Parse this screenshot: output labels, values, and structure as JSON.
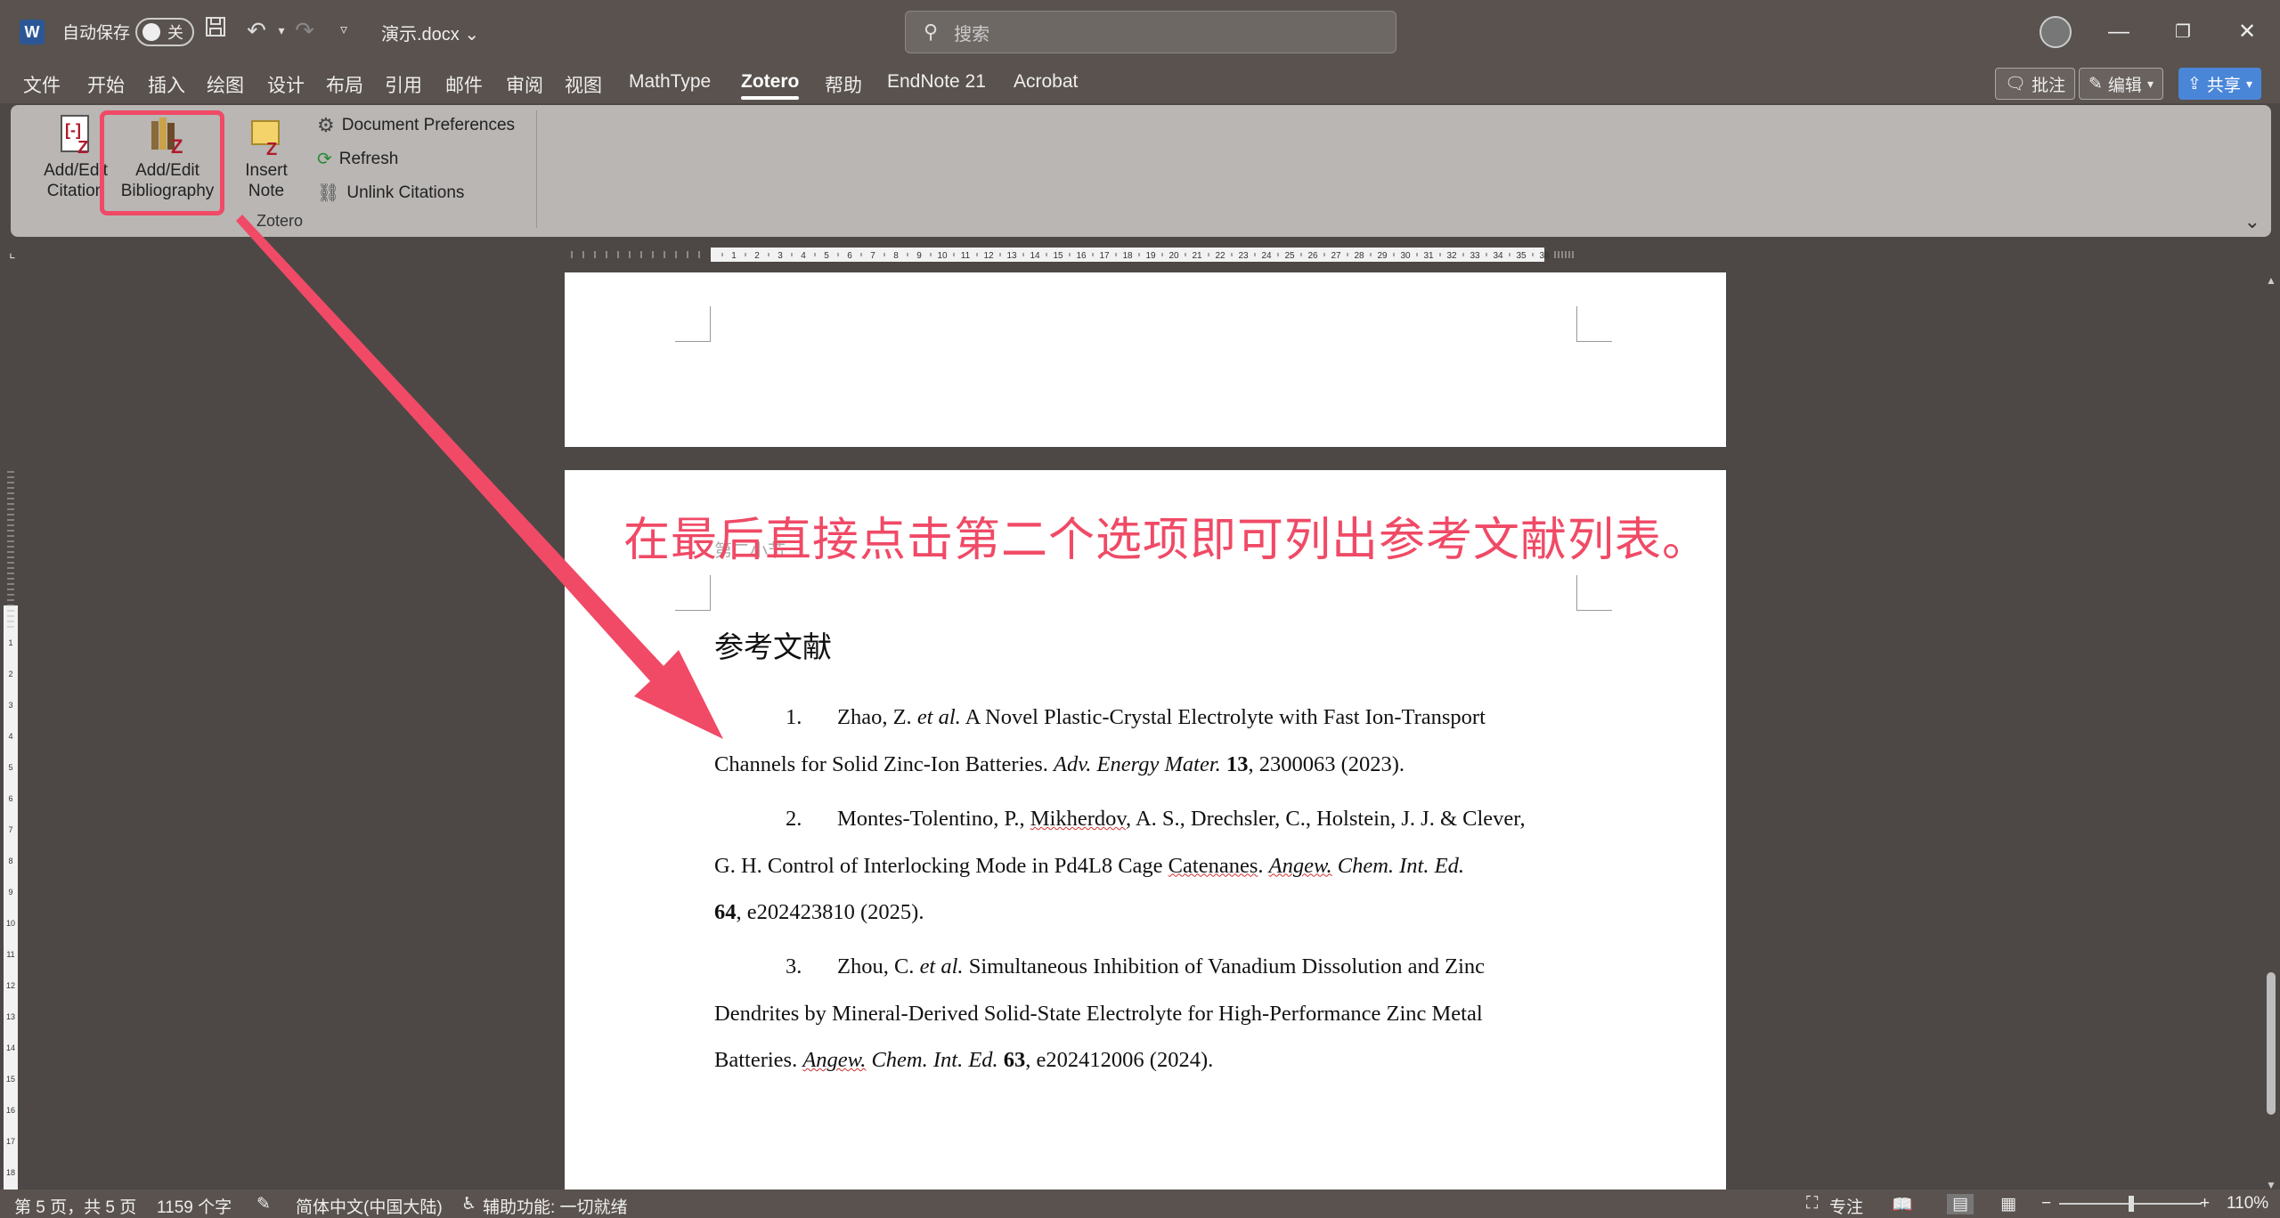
{
  "titlebar": {
    "autosave_label": "自动保存",
    "autosave_state": "关",
    "doc_name": "演示.docx",
    "search_placeholder": "搜索"
  },
  "menu": [
    "文件",
    "开始",
    "插入",
    "绘图",
    "设计",
    "布局",
    "引用",
    "邮件",
    "审阅",
    "视图",
    "MathType",
    "Zotero",
    "帮助",
    "EndNote 21",
    "Acrobat"
  ],
  "active_menu": "Zotero",
  "top_right": {
    "comment": "批注",
    "edit": "编辑",
    "share": "共享"
  },
  "ribbon": {
    "add_edit_citation": [
      "Add/Edit",
      "Citation"
    ],
    "add_edit_bibliography": [
      "Add/Edit",
      "Bibliography"
    ],
    "insert_note": [
      "Insert",
      "Note"
    ],
    "document_preferences": "Document Preferences",
    "refresh": "Refresh",
    "unlink_citations": "Unlink Citations",
    "group_label": "Zotero"
  },
  "ruler_numbers": [
    1,
    2,
    3,
    4,
    5,
    6,
    7,
    8,
    9,
    10,
    11,
    12,
    13,
    14,
    15,
    16,
    17,
    18,
    19,
    20,
    21,
    22,
    23,
    24,
    25,
    26,
    27,
    28,
    29,
    30,
    31,
    32,
    33,
    34,
    35,
    36
  ],
  "annotation": "在最后直接点击第二个选项即可列出参考文献列表。",
  "ghost_text": "第二小节",
  "ref_heading": "参考文献",
  "references": [
    {
      "num": "1.",
      "lines": [
        "Zhao, Z. <i>et al.</i> A Novel Plastic-Crystal Electrolyte with Fast Ion-Transport",
        "Channels for Solid Zinc-Ion Batteries. <i>Adv. Energy Mater.</i> <b>13</b>, 2300063 (2023)."
      ]
    },
    {
      "num": "2.",
      "lines": [
        "Montes-Tolentino, P., <span class=\"squig\">Mikherdov</span>, A. S., Drechsler, C., Holstein, J. J. &amp; Clever,",
        "G. H. Control of Interlocking Mode in Pd4L8 Cage <span class=\"squig\">Catenanes</span>. <i><span class=\"squig\">Angew.</span> Chem. Int. Ed.</i>",
        "<b>64</b>, e202423810 (2025)."
      ]
    },
    {
      "num": "3.",
      "lines": [
        "Zhou, C. <i>et al.</i> Simultaneous Inhibition of Vanadium Dissolution and Zinc",
        "Dendrites by Mineral-Derived Solid-State Electrolyte for High-Performance Zinc Metal",
        "Batteries. <i><span class=\"squig\">Angew.</span> Chem. Int. Ed.</i> <b>63</b>, e202412006 (2024)."
      ]
    }
  ],
  "status": {
    "page": "第 5 页，共 5 页",
    "words": "1159 个字",
    "language": "简体中文(中国大陆)",
    "accessibility": "辅助功能: 一切就绪",
    "focus": "专注",
    "zoom": "110%"
  },
  "colors": {
    "accent": "#f04a66",
    "share": "#4a86d8",
    "titlebar": "#5a524e",
    "ribbon": "#b9b6b4"
  }
}
